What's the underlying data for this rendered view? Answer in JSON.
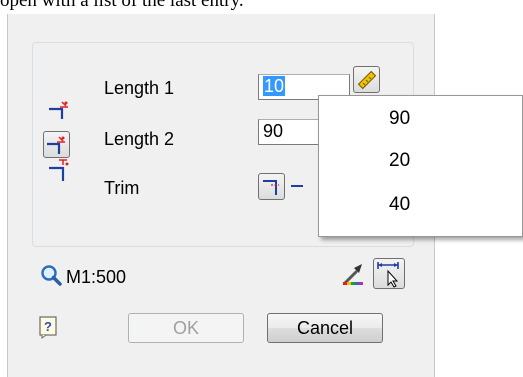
{
  "caption": "open with a list of the last entry.",
  "rows": [
    {
      "label": "Length 1",
      "value": "10"
    },
    {
      "label": "Length 2",
      "value": "90"
    },
    {
      "label": "Trim"
    }
  ],
  "scale": {
    "label": "M1:500"
  },
  "buttons": {
    "ok": "OK",
    "cancel": "Cancel"
  },
  "dropdown": {
    "items": [
      "90",
      "20",
      "40"
    ]
  },
  "icons": {
    "row1": "length-1-icon",
    "row2": "length-2-icon",
    "row3": "trim-icon",
    "ruler": "ruler-icon",
    "trim_option": "trim-option-icon",
    "zoom": "magnifier-icon",
    "paint": "paint-brush-icon",
    "pick": "pick-distance-icon",
    "help": "help-icon"
  },
  "colors": {
    "dialog_bg": "#f0f0f0",
    "selection": "#3399ff",
    "accent_red": "#e02020"
  }
}
